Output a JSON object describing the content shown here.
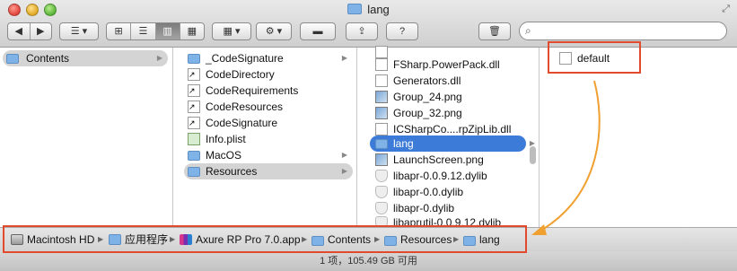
{
  "window": {
    "title": "lang",
    "folder_icon": "folder-icon",
    "fullscreen_icon": "fullscreen-arrows-icon"
  },
  "toolbar": {
    "back_glyph": "◀",
    "forward_glyph": "▶",
    "arrange_glyph": "☰ ▾",
    "view_icon": "⊞",
    "view_list": "☰",
    "view_column": "▥",
    "view_coverflow": "▦",
    "arrange2_glyph": "▦ ▾",
    "action_glyph": "⚙ ▾",
    "toggle_glyph": "▬",
    "share_glyph": "⇪",
    "info_glyph": "?",
    "trash_glyph": "🗑",
    "search_placeholder": "",
    "search_icon": "🔍"
  },
  "column1": {
    "items": [
      {
        "label": "Contents",
        "icon": "folder-icon",
        "chevron": "▶"
      }
    ]
  },
  "column2": {
    "items": [
      {
        "label": "_CodeSignature",
        "icon": "folder-icon",
        "chevron": "▶"
      },
      {
        "label": "CodeDirectory",
        "icon": "alias-document-icon"
      },
      {
        "label": "CodeRequirements",
        "icon": "alias-document-icon"
      },
      {
        "label": "CodeResources",
        "icon": "alias-document-icon"
      },
      {
        "label": "CodeSignature",
        "icon": "alias-document-icon"
      },
      {
        "label": "Info.plist",
        "icon": "plist-icon"
      },
      {
        "label": "MacOS",
        "icon": "folder-icon",
        "chevron": "▶"
      },
      {
        "label": "Resources",
        "icon": "folder-icon",
        "chevron": "▶"
      }
    ]
  },
  "column3": {
    "items": [
      {
        "label": "FSharp.PowerPack.dll",
        "icon": "document-icon"
      },
      {
        "label": "Generators.dll",
        "icon": "document-icon"
      },
      {
        "label": "Group_24.png",
        "icon": "image-icon"
      },
      {
        "label": "Group_32.png",
        "icon": "image-icon"
      },
      {
        "label": "ICSharpCo....rpZipLib.dll",
        "icon": "document-icon"
      },
      {
        "label": "lang",
        "icon": "folder-icon",
        "chevron": "▶"
      },
      {
        "label": "LaunchScreen.png",
        "icon": "image-icon"
      },
      {
        "label": "libapr-0.0.9.12.dylib",
        "icon": "dylib-icon"
      },
      {
        "label": "libapr-0.0.dylib",
        "icon": "dylib-icon"
      },
      {
        "label": "libapr-0.dylib",
        "icon": "dylib-icon"
      },
      {
        "label": "libaprutil-0.0.9.12.dylib",
        "icon": "dylib-icon"
      }
    ]
  },
  "column4": {
    "items": [
      {
        "label": "default",
        "icon": "document-icon"
      }
    ]
  },
  "pathbar": {
    "crumbs": [
      {
        "label": "Macintosh HD",
        "icon": "hard-disk-icon"
      },
      {
        "label": "应用程序",
        "icon": "applications-folder-icon"
      },
      {
        "label": "Axure RP Pro 7.0.app",
        "icon": "axure-app-icon"
      },
      {
        "label": "Contents",
        "icon": "folder-icon"
      },
      {
        "label": "Resources",
        "icon": "folder-icon"
      },
      {
        "label": "lang",
        "icon": "folder-icon"
      }
    ],
    "separator": "▶"
  },
  "status": {
    "text": "1 项，105.49 GB 可用"
  },
  "annotations": {
    "box_color": "#e24a2e",
    "arrow_color": "#f0a030"
  }
}
